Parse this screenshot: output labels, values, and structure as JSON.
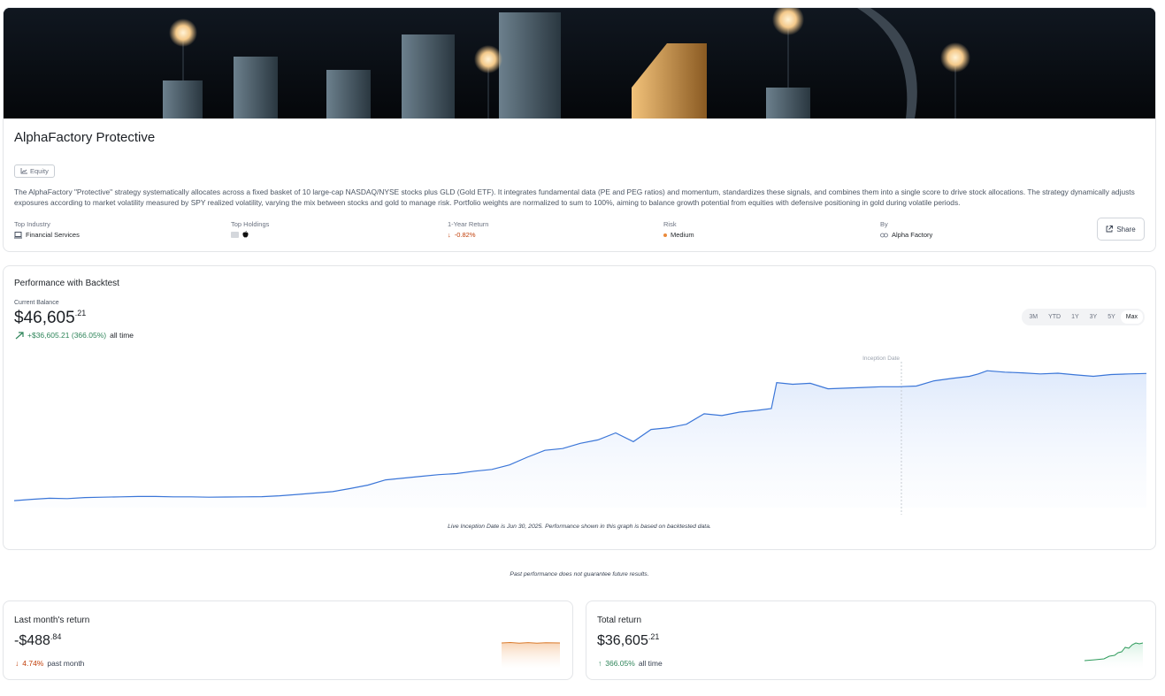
{
  "strategy": {
    "title": "AlphaFactory Protective",
    "tag_label": "Equity",
    "description": "The AlphaFactory \"Protective\" strategy systematically allocates across a fixed basket of 10 large-cap NASDAQ/NYSE stocks plus GLD (Gold ETF). It integrates fundamental data (PE and PEG ratios) and momentum, standardizes these signals, and combines them into a single score to drive stock allocations. The strategy dynamically adjusts exposures according to market volatility measured by SPY realized volatility, varying the mix between stocks and gold to manage risk. Portfolio weights are normalized to sum to 100%, aiming to balance growth potential from equities with defensive positioning in gold during volatile periods.",
    "stats": {
      "industry_label": "Top Industry",
      "industry_value": "Financial Services",
      "holdings_label": "Top Holdings",
      "return_label": "1-Year Return",
      "return_value": "-0.82%",
      "risk_label": "Risk",
      "risk_value": "Medium",
      "by_label": "By",
      "by_value": "Alpha Factory"
    },
    "share_label": "Share",
    "colors": {
      "negative": "#c2410c",
      "positive": "#2f855a",
      "risk_medium": "#ea8a3a",
      "line": "#3b76d8"
    }
  },
  "performance": {
    "title": "Performance with Backtest",
    "balance_label": "Current Balance",
    "balance_main": "$46,605",
    "balance_cents": ".21",
    "change_value": "+$36,605.21 (366.05%)",
    "change_suffix": "all time",
    "ranges": [
      "3M",
      "YTD",
      "1Y",
      "3Y",
      "5Y",
      "Max"
    ],
    "active_range": "Max",
    "inception_label": "Inception Date",
    "note": "Live Inception Date is Jun 30, 2025. Performance shown in this graph is based on backtested data."
  },
  "disclaimer": "Past performance does not guarantee future results.",
  "last_month": {
    "title": "Last month's return",
    "value_main": "-$488",
    "value_cents": ".84",
    "change_value": "4.74%",
    "change_suffix": "past month"
  },
  "total_return": {
    "title": "Total return",
    "value_main": "$36,605",
    "value_cents": ".21",
    "change_value": "366.05%",
    "change_suffix": "all time"
  },
  "chart_data": {
    "type": "area",
    "title": "",
    "xlabel": "",
    "ylabel": "",
    "y_unit": "$",
    "grid": false,
    "x_index": [
      0,
      20,
      40,
      60,
      80,
      100,
      120,
      140,
      160,
      180,
      200,
      220,
      240,
      260,
      280,
      300,
      320,
      340,
      360,
      380,
      400,
      420,
      440,
      460,
      480,
      500,
      520,
      540,
      560,
      580,
      600,
      620,
      640,
      660,
      680,
      700,
      720,
      740,
      760,
      780,
      800,
      820,
      840,
      856,
      862,
      880,
      900,
      920,
      940,
      960,
      980,
      1000,
      1020,
      1040,
      1060,
      1080,
      1090,
      1100,
      1120,
      1140,
      1160,
      1180,
      1200,
      1220,
      1240,
      1260,
      1280
    ],
    "values": [
      10000,
      10400,
      10700,
      10600,
      10900,
      11000,
      11100,
      11200,
      11200,
      11100,
      11100,
      11000,
      11050,
      11100,
      11150,
      11400,
      11800,
      12200,
      12600,
      13500,
      14500,
      16000,
      16500,
      17000,
      17500,
      17800,
      18500,
      19000,
      20300,
      22500,
      24500,
      25000,
      26500,
      27500,
      29500,
      27000,
      30500,
      31000,
      32000,
      35000,
      34500,
      35500,
      36000,
      36500,
      44000,
      43500,
      43800,
      42200,
      42400,
      42600,
      42800,
      42800,
      43000,
      44500,
      45200,
      45800,
      46500,
      47400,
      47000,
      46800,
      46500,
      46700,
      46200,
      45800,
      46300,
      46500,
      46605
    ],
    "ylim": [
      8000,
      50000
    ],
    "inception_index": 1003
  }
}
